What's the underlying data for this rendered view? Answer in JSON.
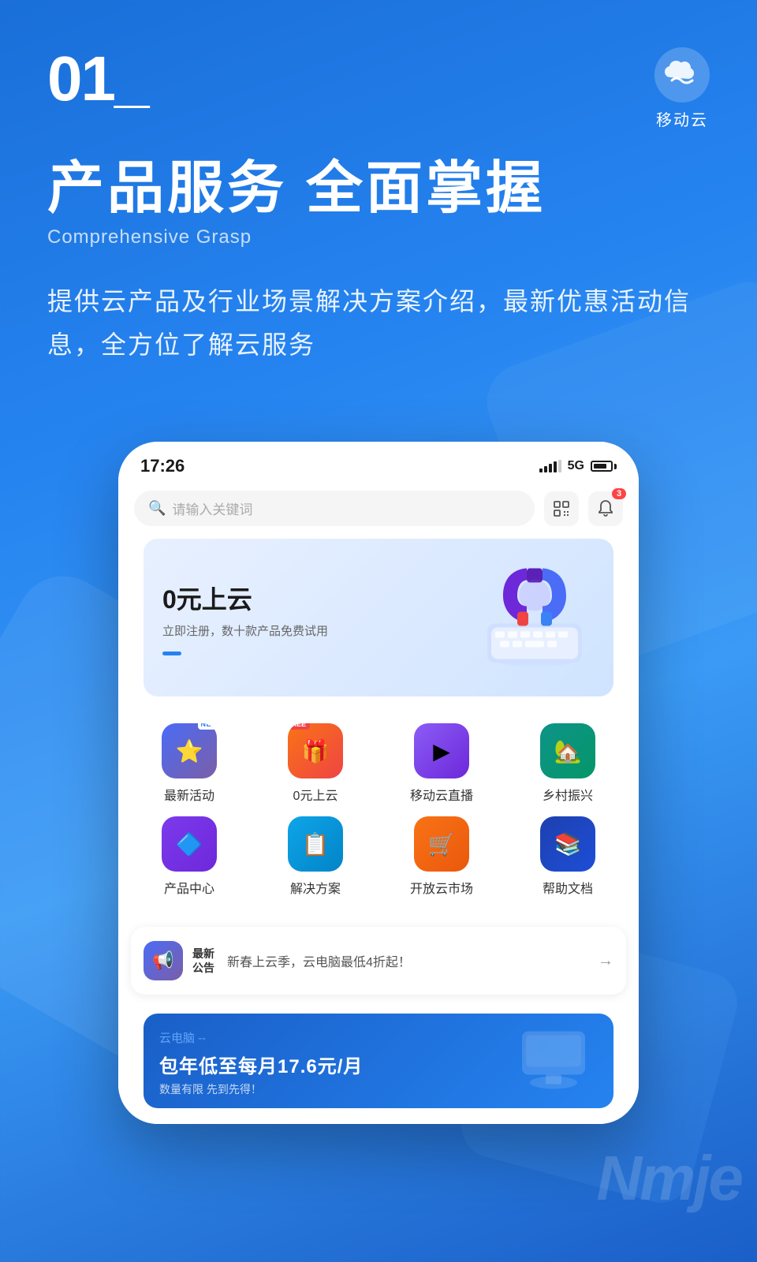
{
  "background": {
    "gradient_start": "#1a6fd8",
    "gradient_end": "#1a5fc8"
  },
  "header": {
    "section_number": "01_",
    "logo_text": "移动云"
  },
  "title_section": {
    "main_title": "产品服务 全面掌握",
    "sub_title": "Comprehensive Grasp",
    "description": "提供云产品及行业场景解决方案介绍，最新优惠活动信息，全方位了解云服务"
  },
  "phone": {
    "status_bar": {
      "time": "17:26",
      "signal": "5G",
      "battery_level": "80"
    },
    "search": {
      "placeholder": "请输入关键词",
      "notification_count": "3"
    },
    "banner": {
      "title": "0元上云",
      "subtitle": "立即注册，数十款产品免费试用",
      "dot_indicator": "—"
    },
    "grid_items": [
      {
        "label": "最新活动",
        "icon_type": "activity",
        "badge": "NEW"
      },
      {
        "label": "0元上云",
        "icon_type": "free",
        "badge": "FREE"
      },
      {
        "label": "移动云直播",
        "icon_type": "live",
        "badge": null
      },
      {
        "label": "乡村振兴",
        "icon_type": "rural",
        "badge": null
      },
      {
        "label": "产品中心",
        "icon_type": "product",
        "badge": null
      },
      {
        "label": "解决方案",
        "icon_type": "solution",
        "badge": null
      },
      {
        "label": "开放云市场",
        "icon_type": "market",
        "badge": null
      },
      {
        "label": "帮助文档",
        "icon_type": "help",
        "badge": null
      }
    ],
    "notice": {
      "label": "最新\n公告",
      "text": "新春上云季，云电脑最低4折起！",
      "arrow": "→"
    },
    "bottom_ad": {
      "tag": "云电脑 --",
      "title": "包年低至每月17.6元/月",
      "subtitle": "数量有限 先到先得！"
    }
  },
  "watermark": "Nmje"
}
